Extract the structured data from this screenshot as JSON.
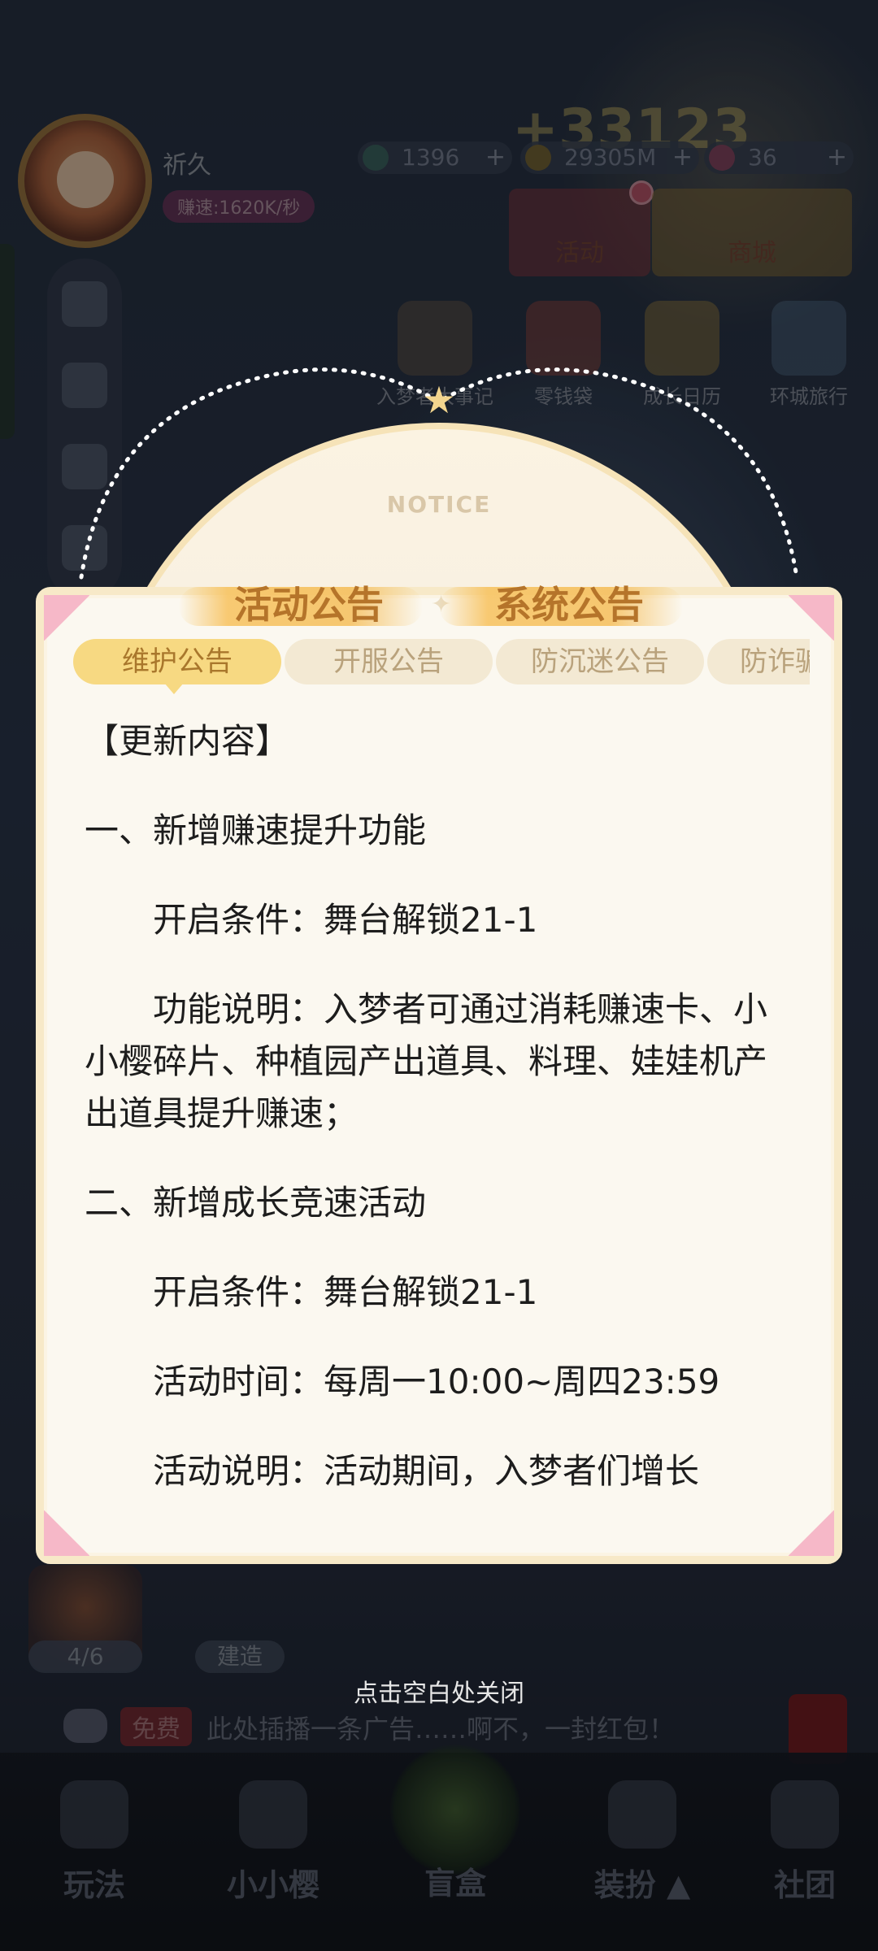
{
  "player": {
    "nickname": "祈久",
    "speed": "赚速:1620K/秒"
  },
  "resources": {
    "gems": "1396",
    "coins": "29305M",
    "stars": "36",
    "big_score": "+33123"
  },
  "top_buttons": {
    "activity": "活动",
    "shop": "商城"
  },
  "features": [
    {
      "label": "入梦者大事记"
    },
    {
      "label": "零钱袋"
    },
    {
      "label": "成长日历"
    },
    {
      "label": "环城旅行"
    }
  ],
  "dialog": {
    "notice_word": "NOTICE",
    "main_tabs": [
      "活动公告",
      "系统公告"
    ],
    "sub_tabs": [
      "维护公告",
      "开服公告",
      "防沉迷公告",
      "防诈骗"
    ],
    "active_sub_tab": 0,
    "content": {
      "heading": "【更新内容】",
      "section1_title": "一、新增赚速提升功能",
      "section1_condition": "开启条件：舞台解锁21-1",
      "section1_desc": "功能说明：入梦者可通过消耗赚速卡、小小樱碎片、种植园产出道具、料理、娃娃机产出道具提升赚速；",
      "section2_title": "二、新增成长竞速活动",
      "section2_condition": "开启条件：舞台解锁21-1",
      "section2_time": "活动时间：每周一10:00~周四23:59",
      "section2_desc": "活动说明：活动期间，入梦者们增长"
    }
  },
  "close_hint": "点击空白处关闭",
  "gift_count": "4/6",
  "build_label": "建造",
  "ad": {
    "free_label": "免费",
    "text": "此处插播一条广告……啊不，一封红包！"
  },
  "bottom_nav": {
    "play": "玩法",
    "sakura": "小小樱",
    "blindbox": "盲盒",
    "dressup": "装扮",
    "club": "社团"
  },
  "colors": {
    "accent_gold": "#f7d982",
    "tab_text": "#b5742a",
    "panel_bg": "#fbf8f0",
    "corner_pink": "#f6b8c8"
  }
}
